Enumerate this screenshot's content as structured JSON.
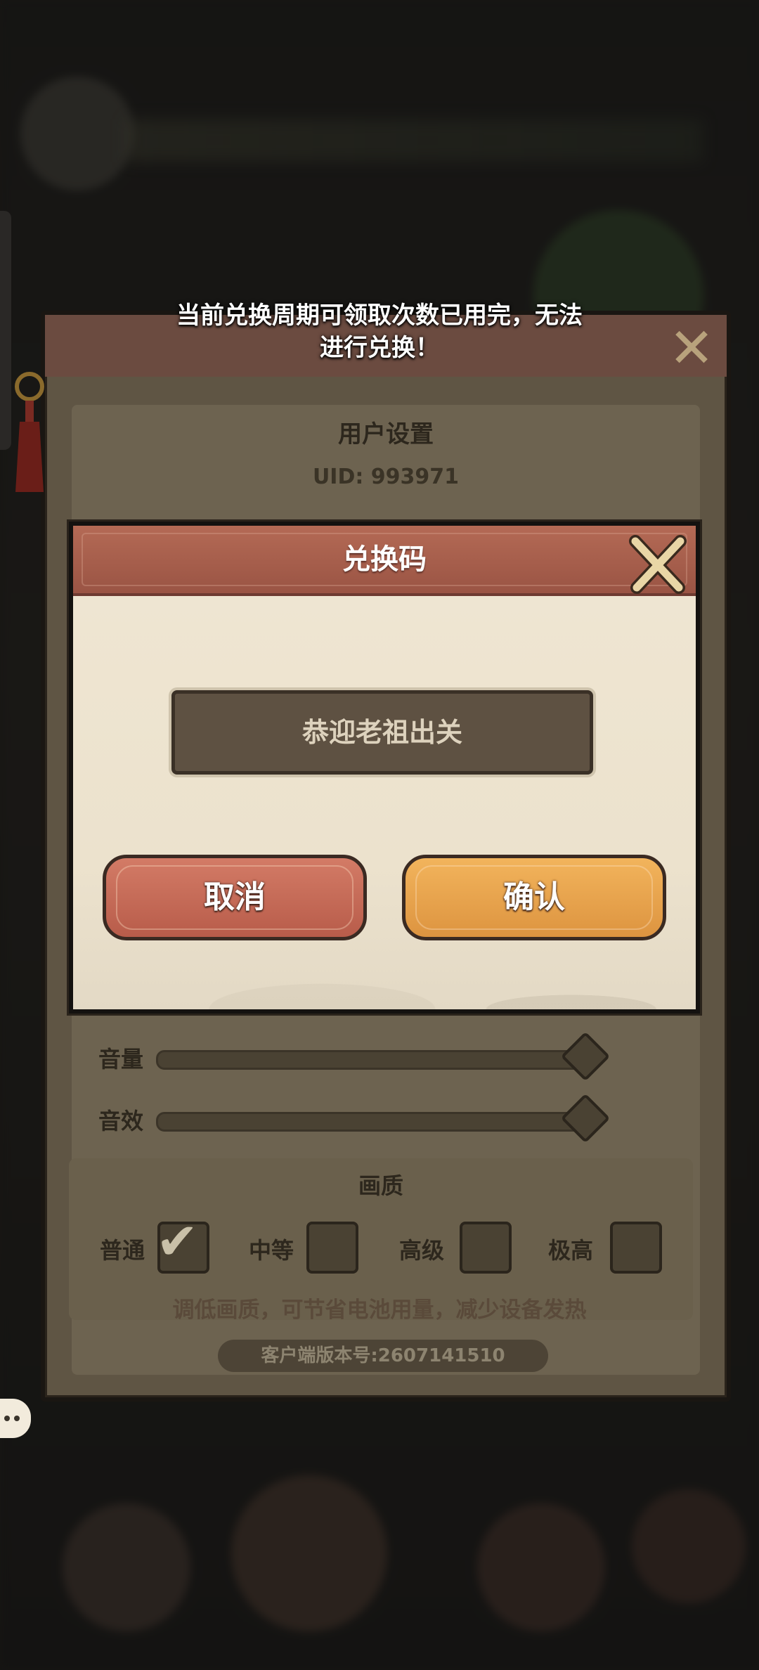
{
  "toast": {
    "line1": "当前兑换周期可领取次数已用完，无法",
    "line2": "进行兑换！"
  },
  "settings": {
    "user_title": "用户设置",
    "uid": "UID: 993971",
    "volume_label": "音量",
    "sfx_label": "音效",
    "volume_level": 1.0,
    "sfx_level": 1.0,
    "quality_title": "画质",
    "quality_options": [
      {
        "label": "普通",
        "checked": true
      },
      {
        "label": "中等",
        "checked": false
      },
      {
        "label": "高级",
        "checked": false
      },
      {
        "label": "极高",
        "checked": false
      }
    ],
    "quality_note": "调低画质，可节省电池用量，减少设备发热",
    "version": "客户端版本号:2607141510"
  },
  "redeem": {
    "title": "兑换码",
    "code_value": "恭迎老祖出关",
    "cancel_label": "取消",
    "confirm_label": "确认"
  },
  "icons": {
    "close": "close-x-icon",
    "chat": "chat-bubble-icon",
    "check": "checkmark-icon"
  }
}
